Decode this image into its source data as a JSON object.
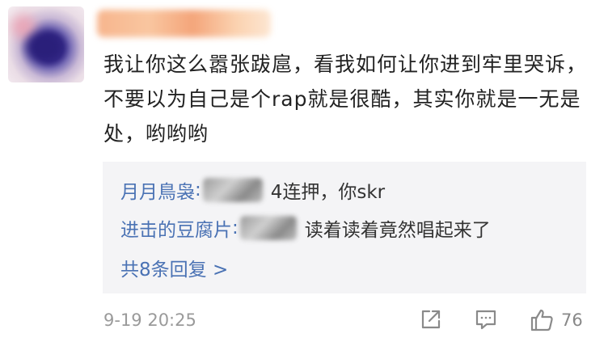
{
  "comment": {
    "text": "我让你这么嚣张跋扈，看我如何让你进到牢里哭诉，不要以为自己是个rap就是很酷，其实你就是一无是处，哟哟哟"
  },
  "replies": [
    {
      "author": "月月鳥袅",
      "colon": ":",
      "text": "4连押，你skr"
    },
    {
      "author": "进击的豆腐片",
      "colon": ":",
      "text": "读着读着竟然唱起来了"
    }
  ],
  "more_replies": "共8条回复 >",
  "footer": {
    "time": "9-19 20:25",
    "likes": "76",
    "icons": [
      "share-icon",
      "comment-icon",
      "like-icon"
    ]
  },
  "colors": {
    "link": "#4a72b4",
    "text": "#222222",
    "muted": "#9a9a9a",
    "reply_bg": "#f4f4f6"
  }
}
